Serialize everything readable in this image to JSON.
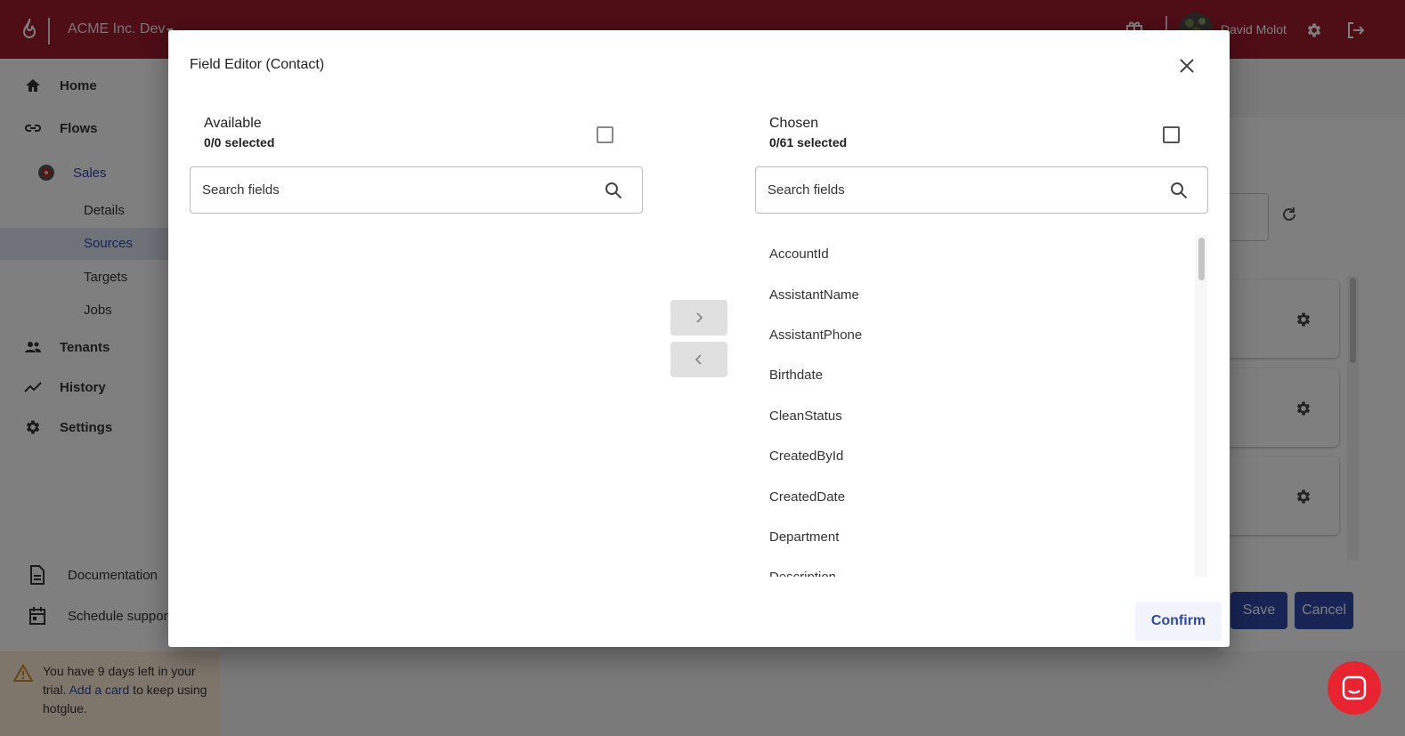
{
  "topbar": {
    "org_name": "ACME Inc. Dev",
    "user_name": "David Molot"
  },
  "sidebar": {
    "items": [
      {
        "label": "Home",
        "icon": "home-icon"
      },
      {
        "label": "Flows",
        "icon": "link-icon"
      },
      {
        "label": "Sales",
        "icon": "flow-logo"
      },
      {
        "label": "Details"
      },
      {
        "label": "Sources"
      },
      {
        "label": "Targets"
      },
      {
        "label": "Jobs"
      },
      {
        "label": "Tenants",
        "icon": "people-icon"
      },
      {
        "label": "History",
        "icon": "trend-icon"
      },
      {
        "label": "Settings",
        "icon": "gear-icon"
      }
    ],
    "bottom": [
      {
        "label": "Documentation",
        "icon": "document-icon"
      },
      {
        "label": "Schedule support",
        "icon": "calendar-icon"
      }
    ],
    "trial": {
      "before": "You have 9 days left in your trial. ",
      "link": "Add a card",
      "after": " to keep using hotglue."
    }
  },
  "main": {
    "save_label": "Save",
    "cancel_label": "Cancel"
  },
  "dialog": {
    "title": "Field Editor (Contact)",
    "available": {
      "title": "Available",
      "count": "0/0 selected",
      "search_placeholder": "Search fields"
    },
    "chosen": {
      "title": "Chosen",
      "count": "0/61 selected",
      "search_placeholder": "Search fields",
      "fields": [
        "AccountId",
        "AssistantName",
        "AssistantPhone",
        "Birthdate",
        "CleanStatus",
        "CreatedById",
        "CreatedDate",
        "Department",
        "Description"
      ]
    },
    "confirm_label": "Confirm"
  },
  "colors": {
    "brand": "#9e1a2d",
    "accent": "#2f49a8",
    "trial_bg": "#fdebd6",
    "chat": "#e9232f"
  }
}
